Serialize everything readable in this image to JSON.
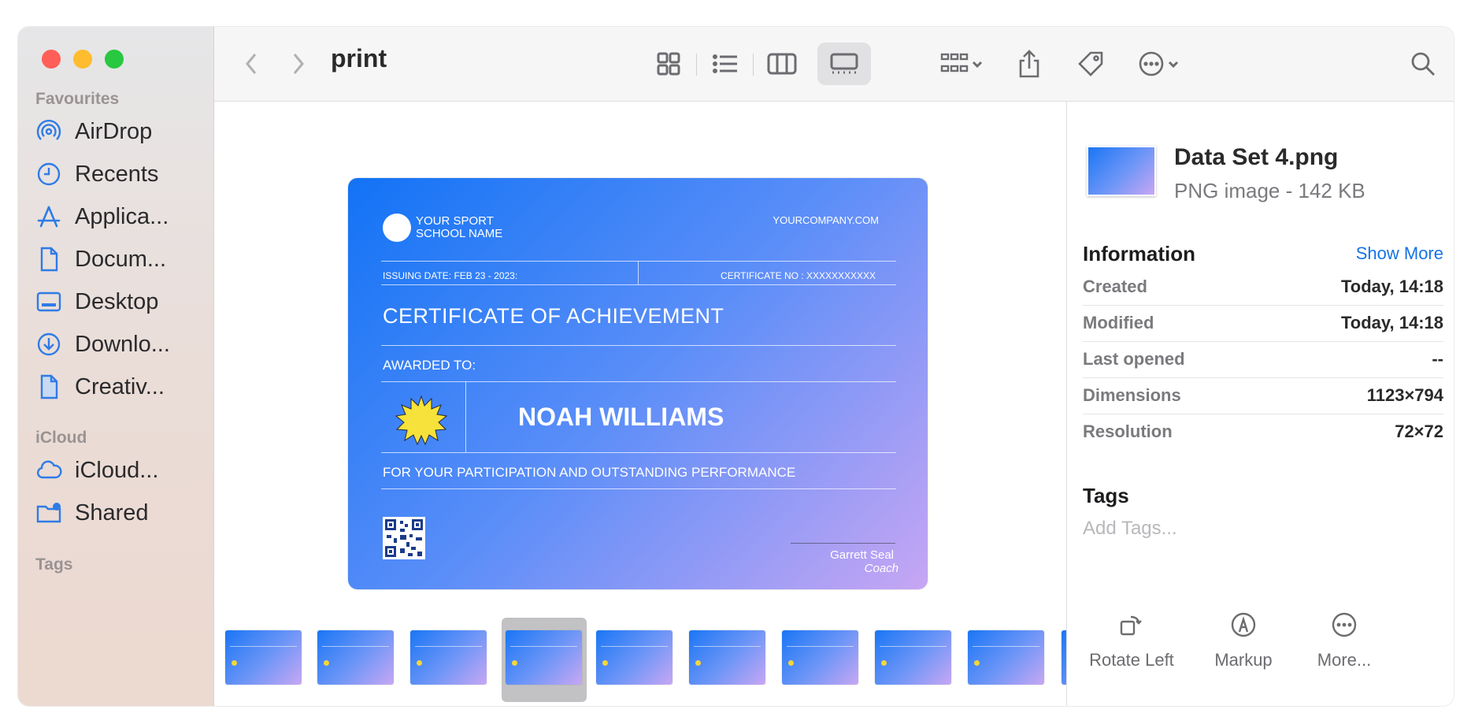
{
  "window": {
    "title": "print"
  },
  "sidebar": {
    "sections": {
      "favourites": "Favourites",
      "icloud": "iCloud",
      "tags": "Tags"
    },
    "favourites": [
      {
        "label": "AirDrop",
        "icon": "airdrop-icon"
      },
      {
        "label": "Recents",
        "icon": "clock-icon"
      },
      {
        "label": "Applica...",
        "icon": "applications-icon"
      },
      {
        "label": "Docum...",
        "icon": "document-icon"
      },
      {
        "label": "Desktop",
        "icon": "desktop-icon"
      },
      {
        "label": "Downlo...",
        "icon": "download-icon"
      },
      {
        "label": "Creativ...",
        "icon": "file-icon"
      }
    ],
    "icloud": [
      {
        "label": "iCloud...",
        "icon": "cloud-icon"
      },
      {
        "label": "Shared",
        "icon": "shared-folder-icon"
      }
    ]
  },
  "preview": {
    "school_line1": "YOUR SPORT",
    "school_line2": "SCHOOL NAME",
    "company": "YOURCOMPANY.COM",
    "issue_date": "ISSUING DATE: FEB 23 - 2023:",
    "certificate_no": "CERTIFICATE NO : XXXXXXXXXXX",
    "heading": "CERTIFICATE OF ACHIEVEMENT",
    "awarded_to": "AWARDED TO:",
    "recipient": "NOAH WILLIAMS",
    "participation": "FOR YOUR PARTICIPATION AND OUTSTANDING PERFORMANCE",
    "signer": "Garrett Seal",
    "signer_role": "Coach"
  },
  "thumbnails": {
    "count": 9,
    "selected_index": 3
  },
  "inspector": {
    "file_name": "Data Set 4.png",
    "file_kind": "PNG image - 142 KB",
    "information_title": "Information",
    "show_more": "Show More",
    "rows": [
      {
        "key": "Created",
        "value": "Today, 14:18"
      },
      {
        "key": "Modified",
        "value": "Today, 14:18"
      },
      {
        "key": "Last opened",
        "value": "--"
      },
      {
        "key": "Dimensions",
        "value": "1123×794"
      },
      {
        "key": "Resolution",
        "value": "72×72"
      }
    ],
    "tags_title": "Tags",
    "tags_placeholder": "Add Tags...",
    "actions": [
      {
        "label": "Rotate Left",
        "icon": "rotate-left-icon"
      },
      {
        "label": "Markup",
        "icon": "markup-icon"
      },
      {
        "label": "More...",
        "icon": "more-icon"
      }
    ]
  },
  "colors": {
    "accent": "#1673e6",
    "close": "#ff5f57",
    "minimize": "#febc2e",
    "zoom": "#28c840",
    "sidebar_icon": "#2f7be6"
  }
}
